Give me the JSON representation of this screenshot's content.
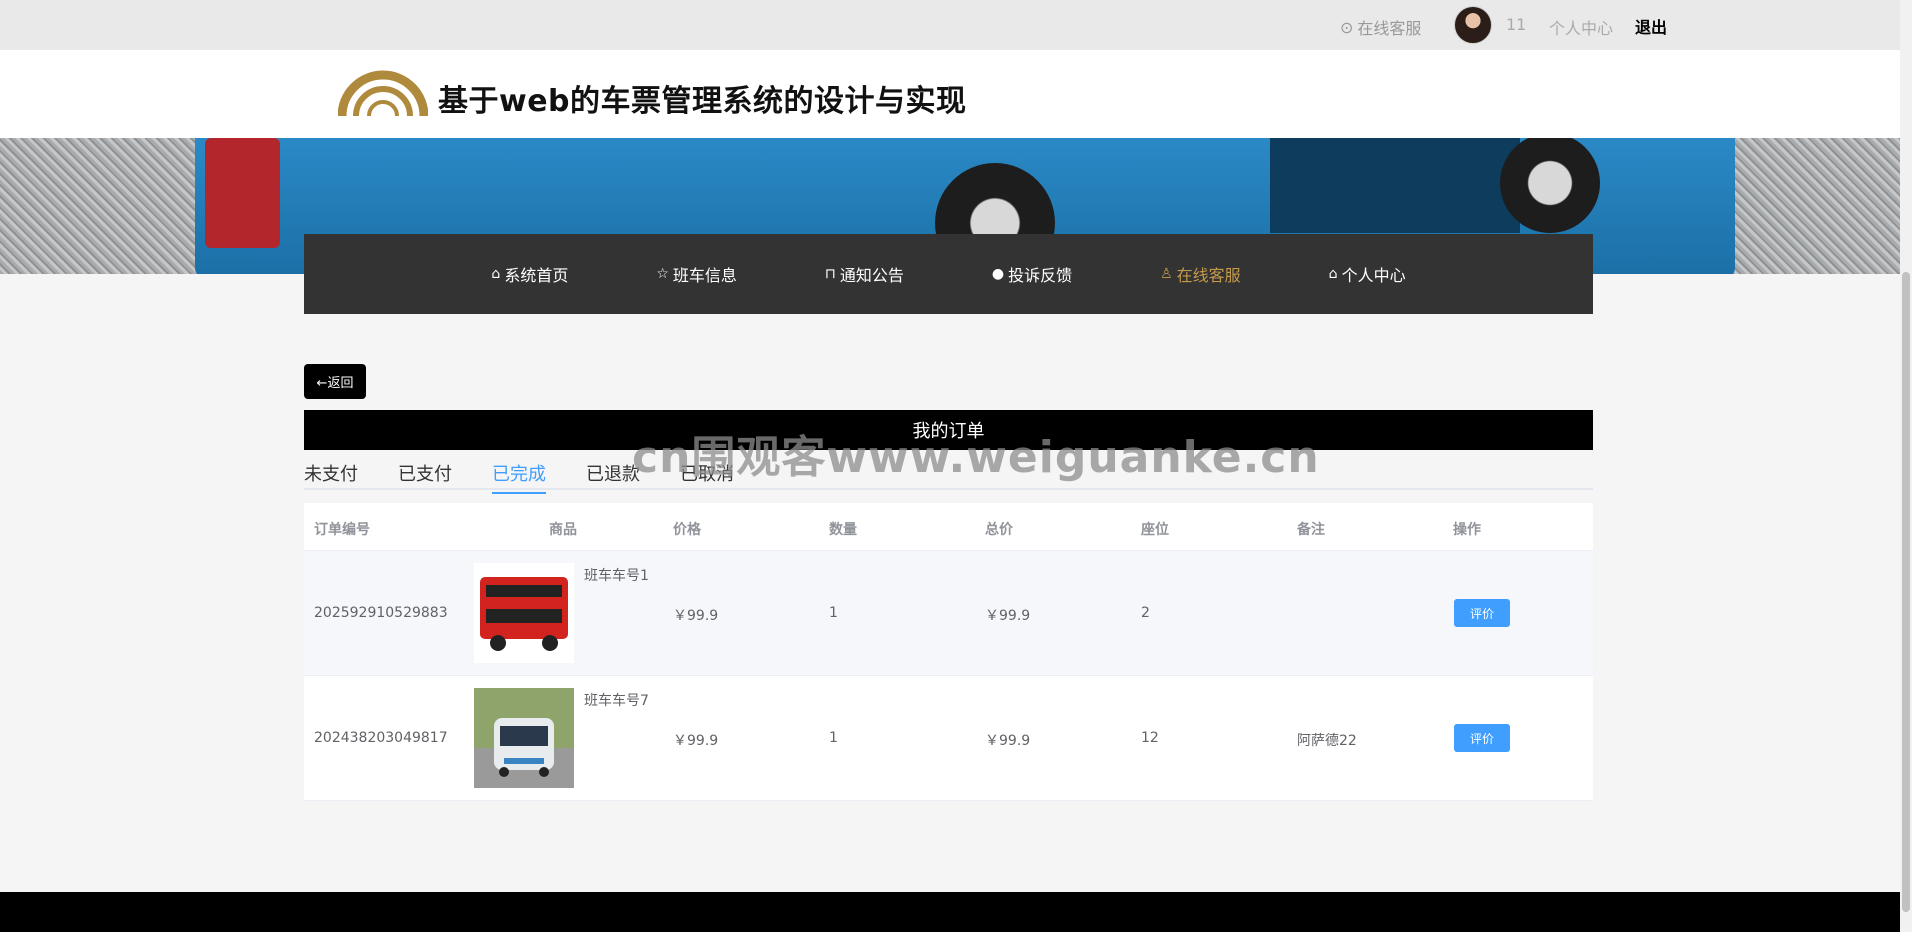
{
  "topbar": {
    "customer_service": "在线客服",
    "username": "11",
    "personal_center": "个人中心",
    "logout": "退出"
  },
  "header": {
    "title": "基于web的车票管理系统的设计与实现"
  },
  "nav": {
    "items": [
      {
        "label": "系统首页",
        "icon": "home-icon"
      },
      {
        "label": "班车信息",
        "icon": "star-icon"
      },
      {
        "label": "通知公告",
        "icon": "bag-icon"
      },
      {
        "label": "投诉反馈",
        "icon": "alert-icon"
      },
      {
        "label": "在线客服",
        "icon": "user-icon"
      },
      {
        "label": "个人中心",
        "icon": "home-icon"
      }
    ],
    "active_index": 4,
    "active_color": "#c49a4b"
  },
  "back_label": "←返回",
  "page_title": "我的订单",
  "watermark": "cn围观客www.weiguanke.cn",
  "tabs": [
    "未支付",
    "已支付",
    "已完成",
    "已退款",
    "已取消"
  ],
  "active_tab": 2,
  "accent_color": "#409eff",
  "table": {
    "headers": [
      "订单编号",
      "商品",
      "价格",
      "数量",
      "总价",
      "座位",
      "备注",
      "操作"
    ],
    "rows": [
      {
        "order_no": "202592910529883",
        "product": "班车车号1",
        "price": "￥99.9",
        "qty": "1",
        "total": "￥99.9",
        "seat": "2",
        "note": "",
        "action": "评价"
      },
      {
        "order_no": "202438203049817",
        "product": "班车车号7",
        "price": "￥99.9",
        "qty": "1",
        "total": "￥99.9",
        "seat": "12",
        "note": "阿萨德22",
        "action": "评价"
      }
    ]
  }
}
